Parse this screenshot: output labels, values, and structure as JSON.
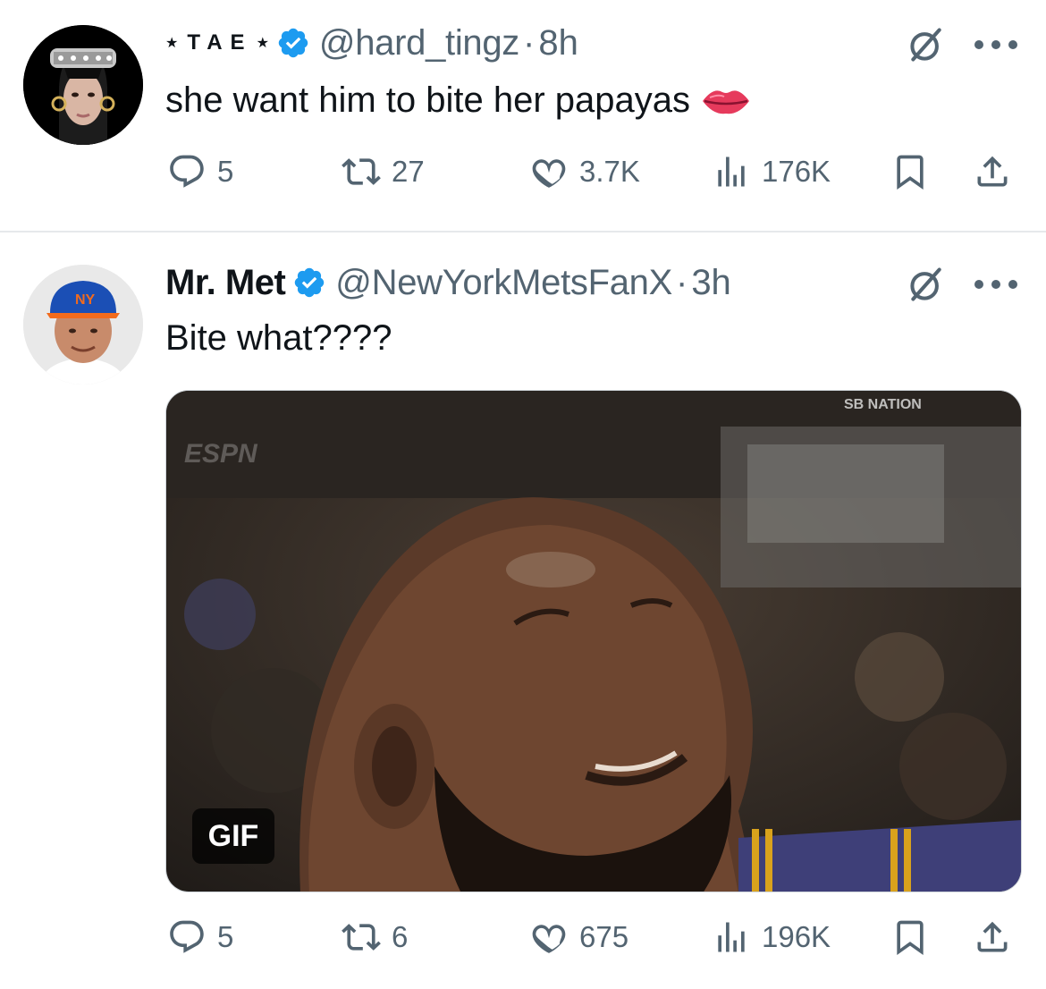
{
  "tweets": [
    {
      "display_name": "TAE",
      "star": "★",
      "handle": "@hard_tingz",
      "separator": "·",
      "time": "8h",
      "text": "she want him to bite her papayas",
      "emoji_icon": "lips-emoji-icon",
      "stats": {
        "replies": "5",
        "reposts": "27",
        "likes": "3.7K",
        "views": "176K"
      }
    },
    {
      "display_name": "Mr. Met",
      "handle": "@NewYorkMetsFanX",
      "separator": "·",
      "time": "3h",
      "text": "Bite what????",
      "media": {
        "badge": "GIF",
        "watermark_left": "ESPN",
        "watermark_right": "SB NATION"
      },
      "stats": {
        "replies": "5",
        "reposts": "6",
        "likes": "675",
        "views": "196K"
      }
    }
  ],
  "icons": [
    "verified-badge-icon",
    "grok-icon",
    "more-icon",
    "reply-icon",
    "repost-icon",
    "like-icon",
    "views-icon",
    "bookmark-icon",
    "share-icon"
  ],
  "colors": {
    "text": "#0f1419",
    "secondary": "#536471",
    "verified": "#1d9bf0",
    "divider": "#e6e9eb"
  }
}
